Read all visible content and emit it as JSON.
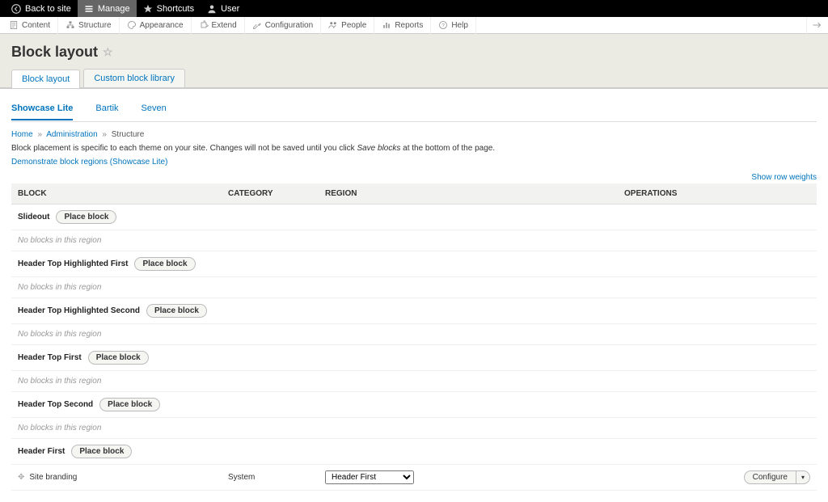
{
  "toolbar": {
    "back": "Back to site",
    "manage": "Manage",
    "shortcuts": "Shortcuts",
    "user": "User"
  },
  "admin_menu": {
    "items": [
      "Content",
      "Structure",
      "Appearance",
      "Extend",
      "Configuration",
      "People",
      "Reports",
      "Help"
    ]
  },
  "page_title": "Block layout",
  "primary_tabs": [
    {
      "label": "Block layout",
      "active": true
    },
    {
      "label": "Custom block library",
      "active": false
    }
  ],
  "secondary_tabs": [
    {
      "label": "Showcase Lite",
      "active": true
    },
    {
      "label": "Bartik",
      "active": false
    },
    {
      "label": "Seven",
      "active": false
    }
  ],
  "breadcrumb": [
    "Home",
    "Administration",
    "Structure"
  ],
  "description_pre": "Block placement is specific to each theme on your site. Changes will not be saved until you click ",
  "description_em": "Save blocks",
  "description_post": " at the bottom of the page.",
  "demo_link": "Demonstrate block regions (Showcase Lite)",
  "show_row_weights": "Show row weights",
  "table": {
    "headers": {
      "block": "Block",
      "category": "Category",
      "region": "Region",
      "operations": "Operations"
    },
    "place_label": "Place block",
    "no_blocks": "No blocks in this region",
    "regions": [
      {
        "name": "Slideout",
        "empty": true
      },
      {
        "name": "Header Top Highlighted First",
        "empty": true
      },
      {
        "name": "Header Top Highlighted Second",
        "empty": true
      },
      {
        "name": "Header Top First",
        "empty": true
      },
      {
        "name": "Header Top Second",
        "empty": true
      },
      {
        "name": "Header First",
        "empty": false,
        "blocks": [
          {
            "title": "Site branding",
            "category": "System",
            "region": "Header First",
            "op": "Configure"
          }
        ]
      }
    ]
  }
}
